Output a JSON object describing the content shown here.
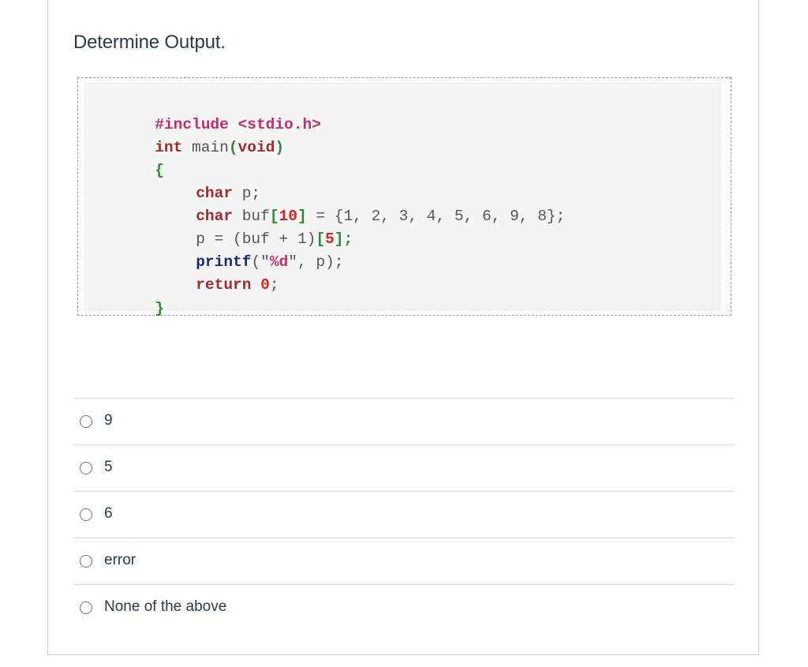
{
  "question": {
    "title": "Determine Output."
  },
  "code": {
    "include_directive": "#include <stdio.h>",
    "ret_type": "int",
    "func_name": " main",
    "paren_open": "(",
    "void_kw": "void",
    "paren_close": ")",
    "brace_open": "{",
    "line1_type": "char",
    "line1_rest": " p;",
    "line2_type": "char",
    "line2_name": " buf",
    "line2_lb": "[",
    "line2_size": "10",
    "line2_rb": "]",
    "line2_rest": " = {1, 2, 3, 4, 5, 6, 9, 8};",
    "line3_start": "p = (buf + 1)",
    "line3_lb": "[",
    "line3_idx": "5",
    "line3_rb": "];",
    "line4_func": "printf",
    "line4_rest": "(\"",
    "line4_fmt": "%d",
    "line4_tail": "\", p);",
    "line5_kw": "return",
    "line5_sp": " ",
    "line5_val": "0",
    "line5_end": ";",
    "brace_close": "}"
  },
  "options": [
    {
      "label": "9"
    },
    {
      "label": "5"
    },
    {
      "label": "6"
    },
    {
      "label": "error"
    },
    {
      "label": "None of the above"
    }
  ]
}
